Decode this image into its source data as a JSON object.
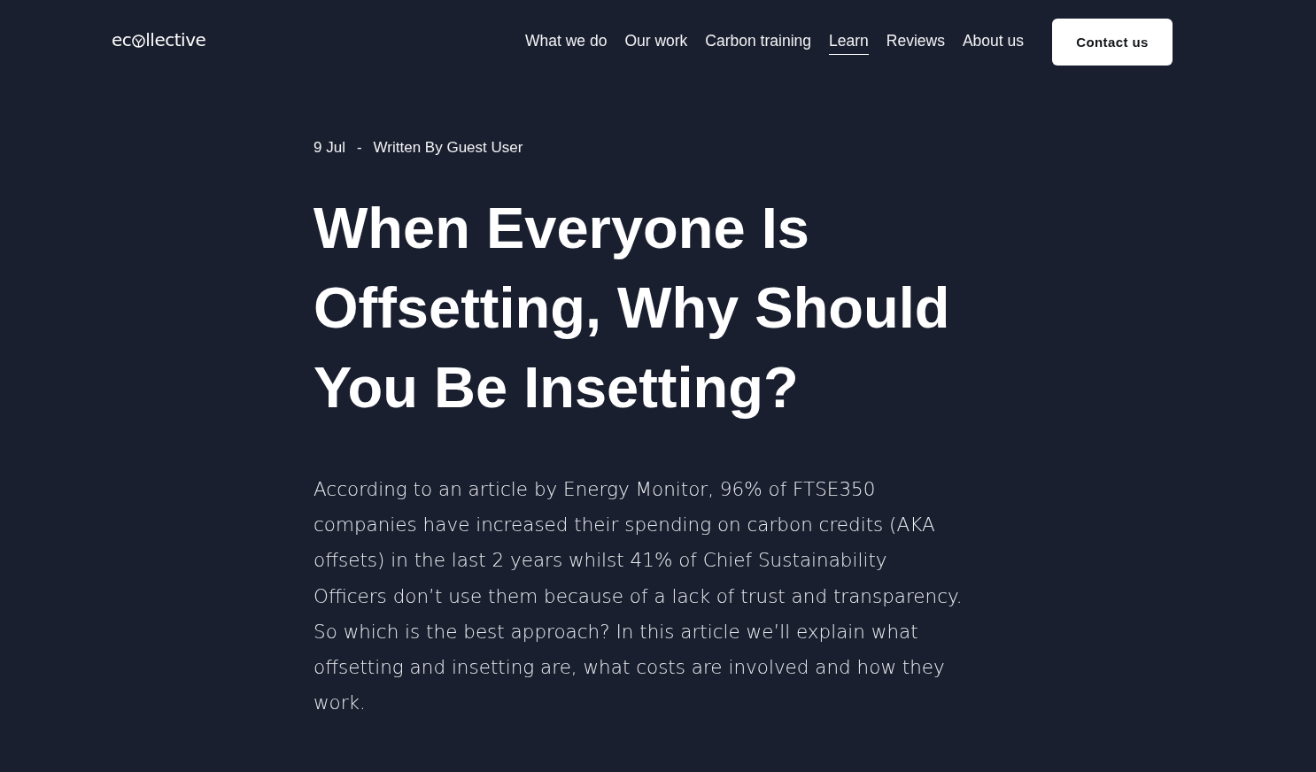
{
  "header": {
    "logo": {
      "parts": [
        "ec",
        "llective"
      ]
    },
    "nav": [
      {
        "label": "What we do",
        "selected": false
      },
      {
        "label": "Our work",
        "selected": false
      },
      {
        "label": "Carbon training",
        "selected": false
      },
      {
        "label": "Learn",
        "selected": true
      },
      {
        "label": "Reviews",
        "selected": false
      },
      {
        "label": "About us",
        "selected": false
      }
    ],
    "cta": "Contact us"
  },
  "article": {
    "meta": {
      "date": "9 Jul",
      "separator": "-",
      "author": "Written By Guest User"
    },
    "title": "When Everyone Is Offsetting, Why Should You Be Insetting?",
    "intro": "According to an article by Energy Monitor, 96% of FTSE350 companies have increased their spending on carbon credits (AKA offsets) in the last 2 years whilst 41% of Chief Sustainability Officers don’t use them because of a lack of trust and transparency. So which is the best approach? In this article we’ll explain what offsetting and insetting are, what costs are involved and how they work."
  }
}
